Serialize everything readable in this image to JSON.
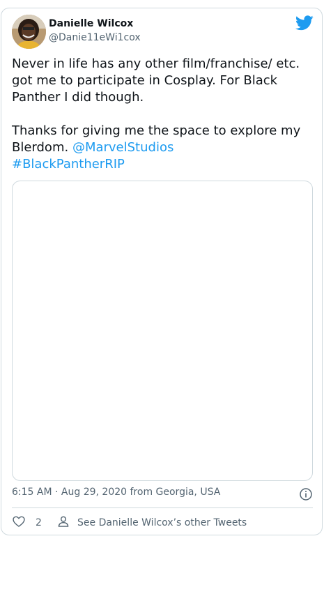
{
  "author": {
    "name": "Danielle Wilcox",
    "handle": "@Danie11eWi1cox"
  },
  "tweet": {
    "line1": "Never in life has any other film/franchise/ etc. got me to participate in Cosplay. For Black Panther I did though.",
    "line2_prefix": "Thanks for giving me the space to explore my Blerdom. ",
    "mention": "@MarvelStudios",
    "hashtag": "#BlackPantherRIP"
  },
  "meta": {
    "time": "6:15 AM",
    "separator": " · ",
    "date": "Aug 29, 2020",
    "from": " from ",
    "location": "Georgia, USA"
  },
  "actions": {
    "like_count": "2",
    "other_tweets_label": "See Danielle Wilcox’s other Tweets"
  },
  "colors": {
    "accent": "#1d9bf0",
    "text": "#0f1419",
    "muted": "#536471",
    "border": "#cfd9de"
  },
  "icons": {
    "brand": "twitter-bird-icon",
    "like": "heart-icon",
    "other": "person-icon",
    "info": "info-icon"
  }
}
